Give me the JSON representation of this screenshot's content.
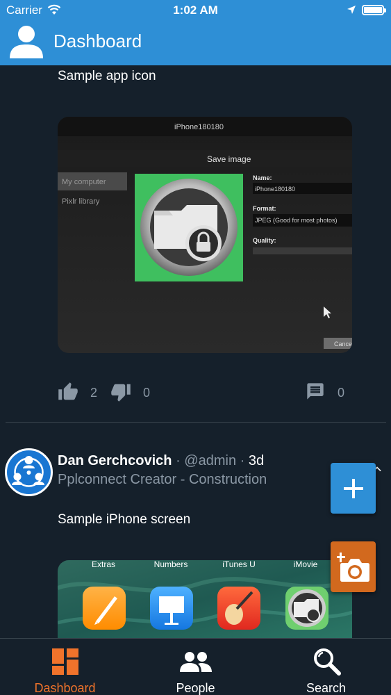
{
  "status_bar": {
    "carrier": "Carrier",
    "time": "1:02 AM"
  },
  "nav": {
    "title": "Dashboard"
  },
  "post1": {
    "text": "Sample app icon",
    "screen": {
      "window_title": "Save image",
      "file_label": "iPhone180180",
      "sidebar_items": [
        "My computer",
        "Pixlr library"
      ],
      "name_label": "Name:",
      "name_value": "iPhone180180",
      "format_label": "Format:",
      "format_value": "JPEG (Good for most photos)",
      "quality_label": "Quality:",
      "cancel_label": "Cancel"
    },
    "likes": "2",
    "dislikes": "0",
    "comments": "0"
  },
  "post2": {
    "author": "Dan Gerchcovich",
    "sep1": " · ",
    "handle": "@admin",
    "sep2": " · ",
    "when": "3d",
    "author_title": "Pplconnect Creator - Construction",
    "text": "Sample iPhone screen",
    "app_labels": [
      "Extras",
      "Numbers",
      "iTunes U",
      "iMovie"
    ]
  },
  "tabs": [
    {
      "label": "Dashboard",
      "icon": "dashboard-icon",
      "active": true
    },
    {
      "label": "People",
      "icon": "people-icon",
      "active": false
    },
    {
      "label": "Search",
      "icon": "search-icon",
      "active": false
    }
  ],
  "colors": {
    "accent_blue": "#2e8fd6",
    "accent_orange": "#f0732b",
    "background": "#15202b"
  }
}
